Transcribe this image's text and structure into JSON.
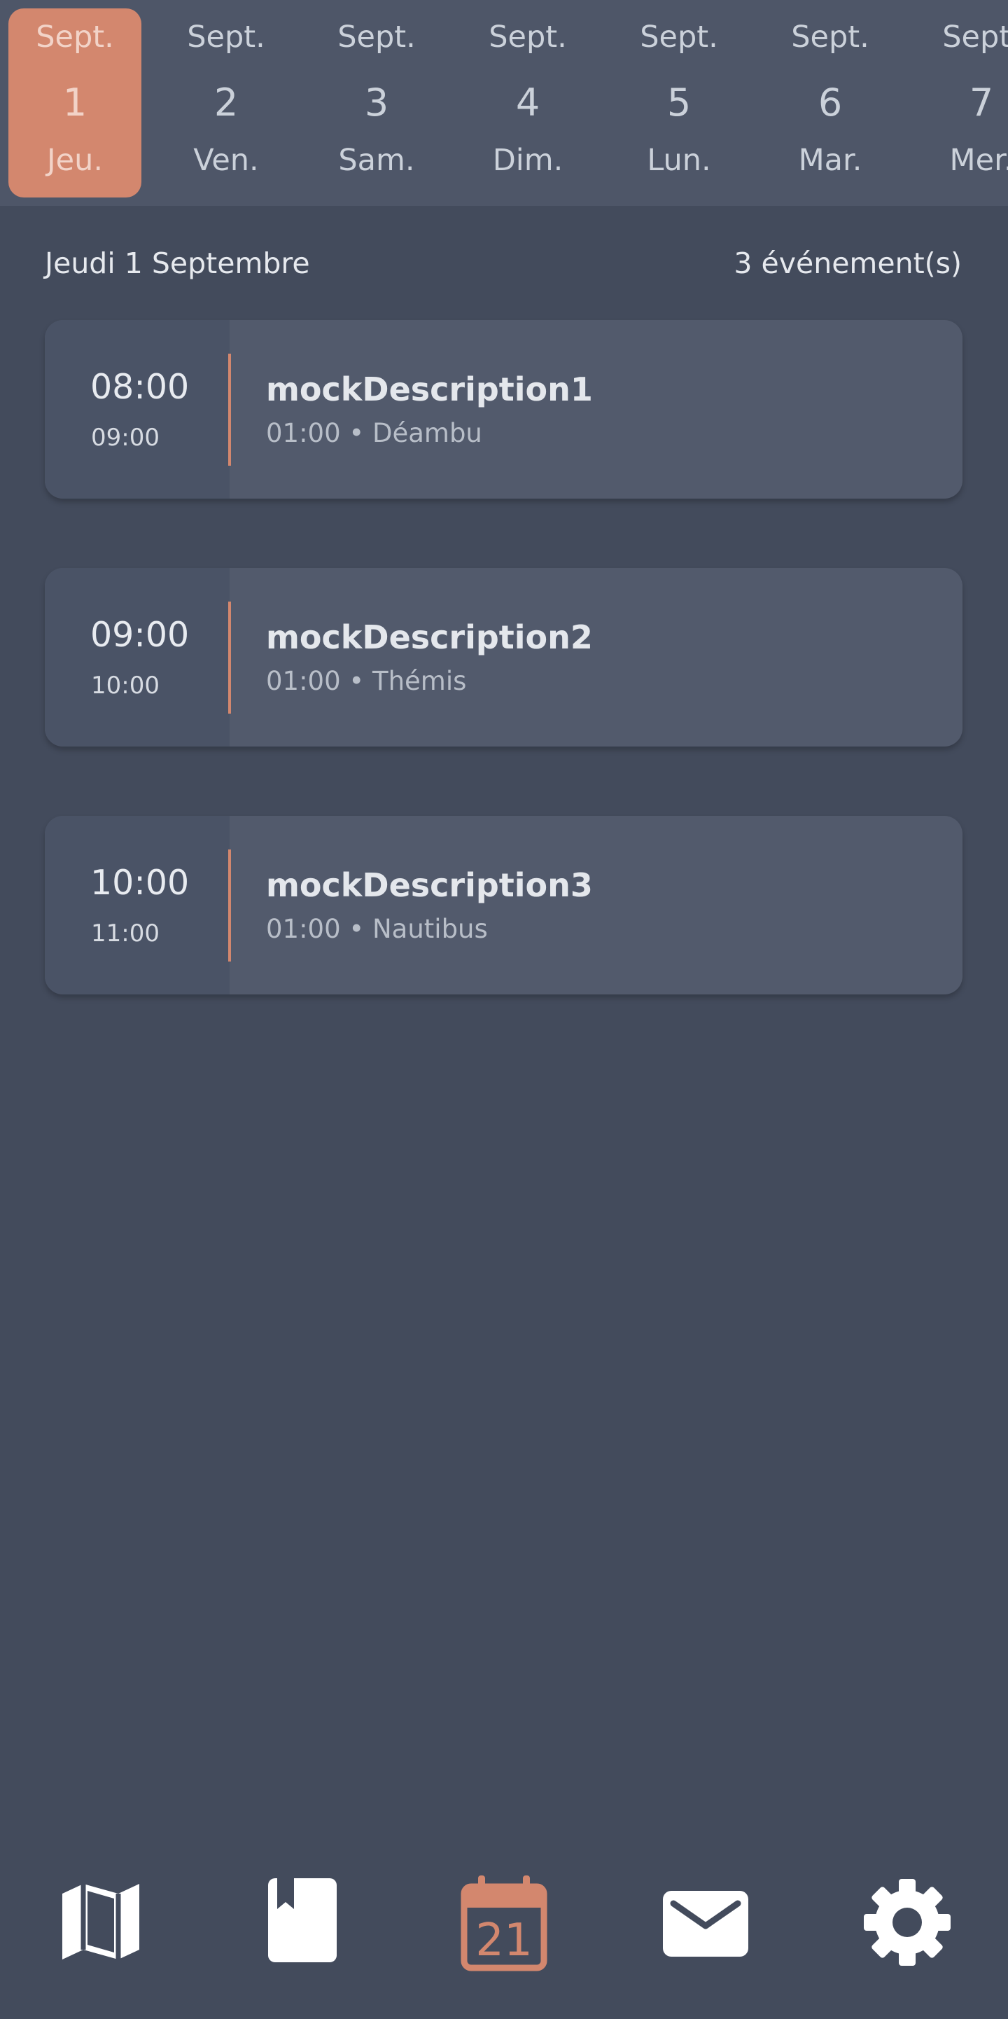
{
  "date_strip": [
    {
      "month": "Sept.",
      "day": "1",
      "weekday": "Jeu.",
      "selected": true
    },
    {
      "month": "Sept.",
      "day": "2",
      "weekday": "Ven."
    },
    {
      "month": "Sept.",
      "day": "3",
      "weekday": "Sam."
    },
    {
      "month": "Sept.",
      "day": "4",
      "weekday": "Dim."
    },
    {
      "month": "Sept.",
      "day": "5",
      "weekday": "Lun."
    },
    {
      "month": "Sept.",
      "day": "6",
      "weekday": "Mar."
    },
    {
      "month": "Sept.",
      "day": "7",
      "weekday": "Mer."
    }
  ],
  "day_header": {
    "date_label": "Jeudi 1 Septembre",
    "count_label": "3 événement(s)"
  },
  "events": [
    {
      "start": "08:00",
      "end": "09:00",
      "title": "mockDescription1",
      "subtitle": "01:00 • Déambu"
    },
    {
      "start": "09:00",
      "end": "10:00",
      "title": "mockDescription2",
      "subtitle": "01:00 • Thémis"
    },
    {
      "start": "10:00",
      "end": "11:00",
      "title": "mockDescription3",
      "subtitle": "01:00 • Nautibus"
    }
  ],
  "bottom_nav": {
    "items": [
      {
        "icon": "map-icon"
      },
      {
        "icon": "bookmark-book-icon"
      },
      {
        "icon": "calendar-icon",
        "active": true,
        "calendar_number": "21"
      },
      {
        "icon": "mail-icon"
      },
      {
        "icon": "gear-icon"
      }
    ]
  },
  "colors": {
    "background": "#434b5c",
    "strip_background": "#4e5668",
    "accent": "#d3876e",
    "card": "#525a6c",
    "card_time_column": "#4a5366",
    "nav_icon": "#ffffff"
  }
}
